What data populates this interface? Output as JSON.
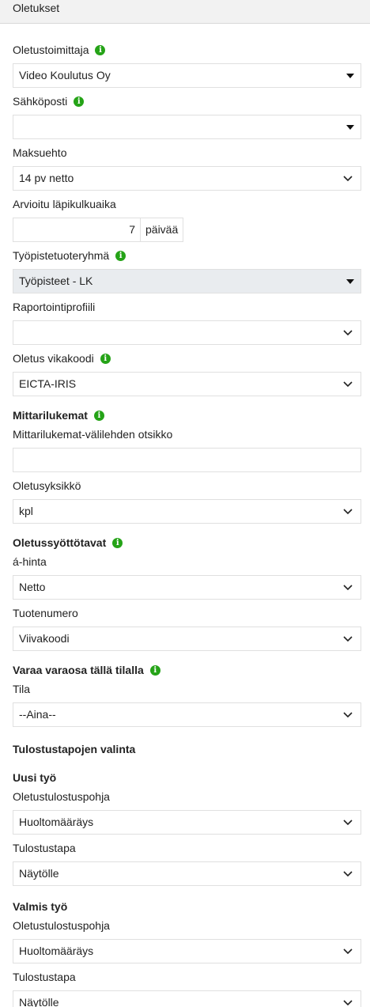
{
  "panel": {
    "title": "Oletukset"
  },
  "fields": {
    "supplier": {
      "label": "Oletustoimittaja",
      "value": "Video Koulutus Oy"
    },
    "email": {
      "label": "Sähköposti",
      "value": ""
    },
    "payment": {
      "label": "Maksuehto",
      "value": "14 pv netto"
    },
    "leadtime": {
      "label": "Arvioitu läpikulkuaika",
      "value": "7",
      "unit": "päivää"
    },
    "workgroup": {
      "label": "Työpistetuoteryhmä",
      "value": "Työpisteet - LK"
    },
    "report": {
      "label": "Raportointiprofiili",
      "value": ""
    },
    "faultcode": {
      "label": "Oletus vikakoodi",
      "value": "EICTA-IRIS"
    }
  },
  "meters": {
    "heading": "Mittarilukemat",
    "tab_title": {
      "label": "Mittarilukemat-välilehden otsikko",
      "value": ""
    },
    "unit": {
      "label": "Oletusyksikkö",
      "value": "kpl"
    }
  },
  "entry": {
    "heading": "Oletussyöttötavat",
    "unit_price": {
      "label": "á-hinta",
      "value": "Netto"
    },
    "product_no": {
      "label": "Tuotenumero",
      "value": "Viivakoodi"
    }
  },
  "reserve": {
    "heading": "Varaa varaosa tällä tilalla",
    "state": {
      "label": "Tila",
      "value": "--Aina--"
    }
  },
  "printing": {
    "heading": "Tulostustapojen valinta",
    "new_job": {
      "heading": "Uusi työ",
      "template": {
        "label": "Oletustulostuspohja",
        "value": "Huoltomääräys"
      },
      "method": {
        "label": "Tulostustapa",
        "value": "Näytölle"
      }
    },
    "done_job": {
      "heading": "Valmis työ",
      "template": {
        "label": "Oletustulostuspohja",
        "value": "Huoltomääräys"
      },
      "method": {
        "label": "Tulostustapa",
        "value": "Näytölle"
      }
    }
  },
  "icons": {
    "info": "info-icon",
    "dropdown": "caret-down-icon",
    "chevron": "chevron-down-icon"
  },
  "colors": {
    "info_green": "#25a317",
    "header_bg": "#f2f2f2",
    "disabled_bg": "#e9ecef"
  }
}
